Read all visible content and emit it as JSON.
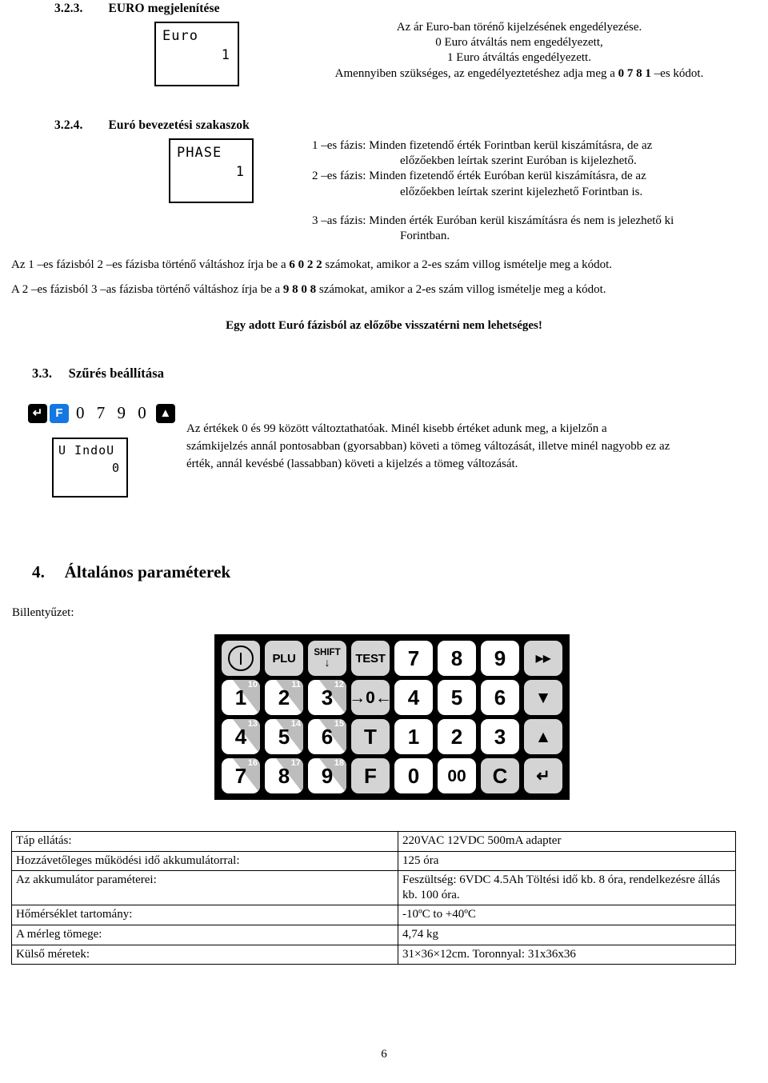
{
  "page": {
    "number": "6"
  },
  "section_323": {
    "number": "3.2.3.",
    "title": "EURO megjelenítése",
    "lcd": {
      "top": "Euro",
      "bottom": "1"
    },
    "lines": [
      "Az ár Euro-ban törénő kijelzésének engedélyezése.",
      "0     Euro átváltás nem engedélyezett,",
      "1     Euro átváltás engedélyezett."
    ],
    "line_code_prefix": "Amennyiben szükséges, az engedélyeztetéshez adja meg a ",
    "line_code": "0 7 8 1",
    "line_code_suffix": " –es kódot."
  },
  "section_324": {
    "number": "3.2.4.",
    "title": "Euró bevezetési szakaszok",
    "lcd": {
      "top": "PHASE",
      "bottom": "1"
    },
    "phases": [
      {
        "lead": "1 –es fázis: Minden fizetendő érték Forintban kerül kiszámításra, de az",
        "cont": "előzőekben leírtak szerint Euróban is kijelezhető."
      },
      {
        "lead": "2 –es fázis: Minden fizetendő érték Euróban kerül kiszámításra, de az",
        "cont": "előzőekben leírtak szerint kijelezhető Forintban is."
      },
      {
        "lead": "3 –as fázis: Minden érték Euróban kerül kiszámításra és nem is jelezhető ki",
        "cont": "Forintban."
      }
    ],
    "switch_1_2": {
      "prefix": "Az 1 –es fázisból 2 –es fázisba történő váltáshoz írja be a ",
      "code": "6 0 2 2",
      "suffix": " számokat, amikor a 2-es szám villog ismételje meg a kódot."
    },
    "switch_2_3": {
      "prefix": "A 2 –es fázisból 3 –as fázisba történő váltáshoz írja be a ",
      "code": "9 8 0 8",
      "suffix": " számokat, amikor a 2-es szám villog ismételje meg a kódot."
    },
    "warning": "Egy adott Euró fázisból az előzőbe visszatérni nem lehetséges!"
  },
  "section_33": {
    "number": "3.3.",
    "title": "Szűrés beállítása",
    "keys": {
      "enter_label": "↵",
      "f_label": "F",
      "digits": "0 7 9 0",
      "up_label": "▲",
      "f_color": "#1478e0",
      "key_color": "#000000"
    },
    "lcd": {
      "top": "U IndoU",
      "bottom": "0"
    },
    "paragraph": "Az értékek 0 és 99 között változtathatóak. Minél kisebb értéket adunk meg, a kijelzőn a számkijelzés annál pontosabban (gyorsabban) követi a tömeg változását, illetve minél nagyobb ez az érték, annál kevésbé (lassabban) követi a kijelzés a tömeg változását."
  },
  "section_4": {
    "number": "4.",
    "title": "Általános paraméterek",
    "keyboard_label": "Billentyűzet:",
    "keypad": {
      "rows": [
        [
          {
            "label": "power",
            "style": "grey",
            "type": "power"
          },
          {
            "label": "PLU",
            "style": "grey",
            "type": "small"
          },
          {
            "label": "SHIFT",
            "style": "grey",
            "type": "shift",
            "arrow": "↓"
          },
          {
            "label": "TEST",
            "style": "grey",
            "type": "small"
          },
          {
            "label": "7",
            "style": "white",
            "type": "digit"
          },
          {
            "label": "8",
            "style": "white",
            "type": "digit"
          },
          {
            "label": "9",
            "style": "white",
            "type": "digit"
          },
          {
            "label": "▶▶",
            "style": "grey",
            "type": "xsmall"
          }
        ],
        [
          {
            "label": "1",
            "style": "white",
            "type": "digit",
            "sup": "10"
          },
          {
            "label": "2",
            "style": "white",
            "type": "digit",
            "sup": "11"
          },
          {
            "label": "3",
            "style": "white",
            "type": "digit",
            "sup": "12"
          },
          {
            "label": "→0←",
            "style": "grey",
            "type": "med"
          },
          {
            "label": "4",
            "style": "white",
            "type": "digit"
          },
          {
            "label": "5",
            "style": "white",
            "type": "digit"
          },
          {
            "label": "6",
            "style": "white",
            "type": "digit"
          },
          {
            "label": "▼",
            "style": "grey",
            "type": "med"
          }
        ],
        [
          {
            "label": "4",
            "style": "white",
            "type": "digit",
            "sup": "13"
          },
          {
            "label": "5",
            "style": "white",
            "type": "digit",
            "sup": "14"
          },
          {
            "label": "6",
            "style": "white",
            "type": "digit",
            "sup": "15"
          },
          {
            "label": "T",
            "style": "grey",
            "type": "digit"
          },
          {
            "label": "1",
            "style": "white",
            "type": "digit"
          },
          {
            "label": "2",
            "style": "white",
            "type": "digit"
          },
          {
            "label": "3",
            "style": "white",
            "type": "digit"
          },
          {
            "label": "▲",
            "style": "grey",
            "type": "med"
          }
        ],
        [
          {
            "label": "7",
            "style": "white",
            "type": "digit",
            "sup": "16"
          },
          {
            "label": "8",
            "style": "white",
            "type": "digit",
            "sup": "17"
          },
          {
            "label": "9",
            "style": "white",
            "type": "digit",
            "sup": "18"
          },
          {
            "label": "F",
            "style": "grey",
            "type": "digit"
          },
          {
            "label": "0",
            "style": "white",
            "type": "digit"
          },
          {
            "label": "00",
            "style": "white",
            "type": "med"
          },
          {
            "label": "C",
            "style": "grey",
            "type": "digit"
          },
          {
            "label": "↵",
            "style": "grey",
            "type": "med"
          }
        ]
      ]
    },
    "spec_table": [
      {
        "key": "Táp ellátás:",
        "value": "220VAC 12VDC 500mA adapter"
      },
      {
        "key": "Hozzávetőleges működési idő akkumulátorral:",
        "value": "125 óra"
      },
      {
        "key": "Az akkumulátor paraméterei:",
        "value": "Feszültség: 6VDC 4.5Ah Töltési idő kb. 8 óra, rendelkezésre állás kb. 100 óra."
      },
      {
        "key": "Hőmérséklet tartomány:",
        "value": "-10ºC to +40ºC"
      },
      {
        "key": "A mérleg tömege:",
        "value": "4,74 kg"
      },
      {
        "key": "Külső méretek:",
        "value": "31×36×12cm. Toronnyal: 31x36x36"
      }
    ]
  }
}
